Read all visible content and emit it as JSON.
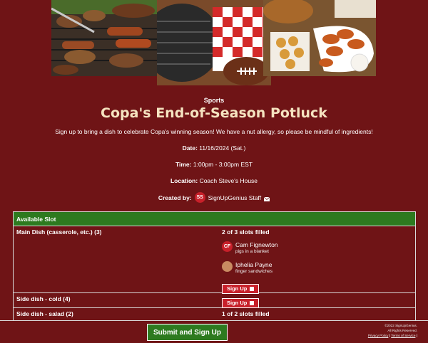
{
  "event": {
    "category": "Sports",
    "title": "Copa's End-of-Season Potluck",
    "description": "Sign up to bring a dish to celebrate Copa's winning season! We have a nut allergy, so please be mindful of ingredients!",
    "date_label": "Date:",
    "date_value": " 11/16/2024 (Sat.)",
    "time_label": "Time:",
    "time_value": " 1:00pm - 3:00pm EST",
    "location_label": "Location:",
    "location_value": " Coach Steve's House",
    "created_by_label": "Created by:",
    "creator_initials": "SS",
    "creator_name": "SignUpGenius Staff"
  },
  "table": {
    "header": "Available Slot",
    "slots": [
      {
        "name": "Main Dish (casserole, etc.) (3)",
        "filled": "2 of 3 slots filled",
        "participants": [
          {
            "initials": "CF",
            "name": "Cam Fignewton",
            "note": "pigs in a blanket"
          },
          {
            "initials": "",
            "name": "Iphelia Payne",
            "note": "finger sandwiches"
          }
        ],
        "button": "Sign Up"
      },
      {
        "name": "Side dish - cold (4)",
        "button": "Sign Up"
      },
      {
        "name": "Side dish - salad (2)",
        "filled": "1 of 2 slots filled"
      }
    ]
  },
  "footer": {
    "submit": "Submit and Sign Up",
    "copyright": "©2022 SignUpGenius.",
    "rights": "All Rights Reserved.",
    "privacy": "Privacy Policy",
    "separator": "|",
    "terms": "Terms of Service",
    "separator2": "|"
  },
  "colors": {
    "background": "#6f1416",
    "accent_green": "#2d7a1f",
    "button_red": "#c8202a",
    "title": "#f5e3c0"
  },
  "icons": [
    "grill-photo",
    "picnic-football-photo",
    "snacks-photo",
    "mail-icon"
  ]
}
